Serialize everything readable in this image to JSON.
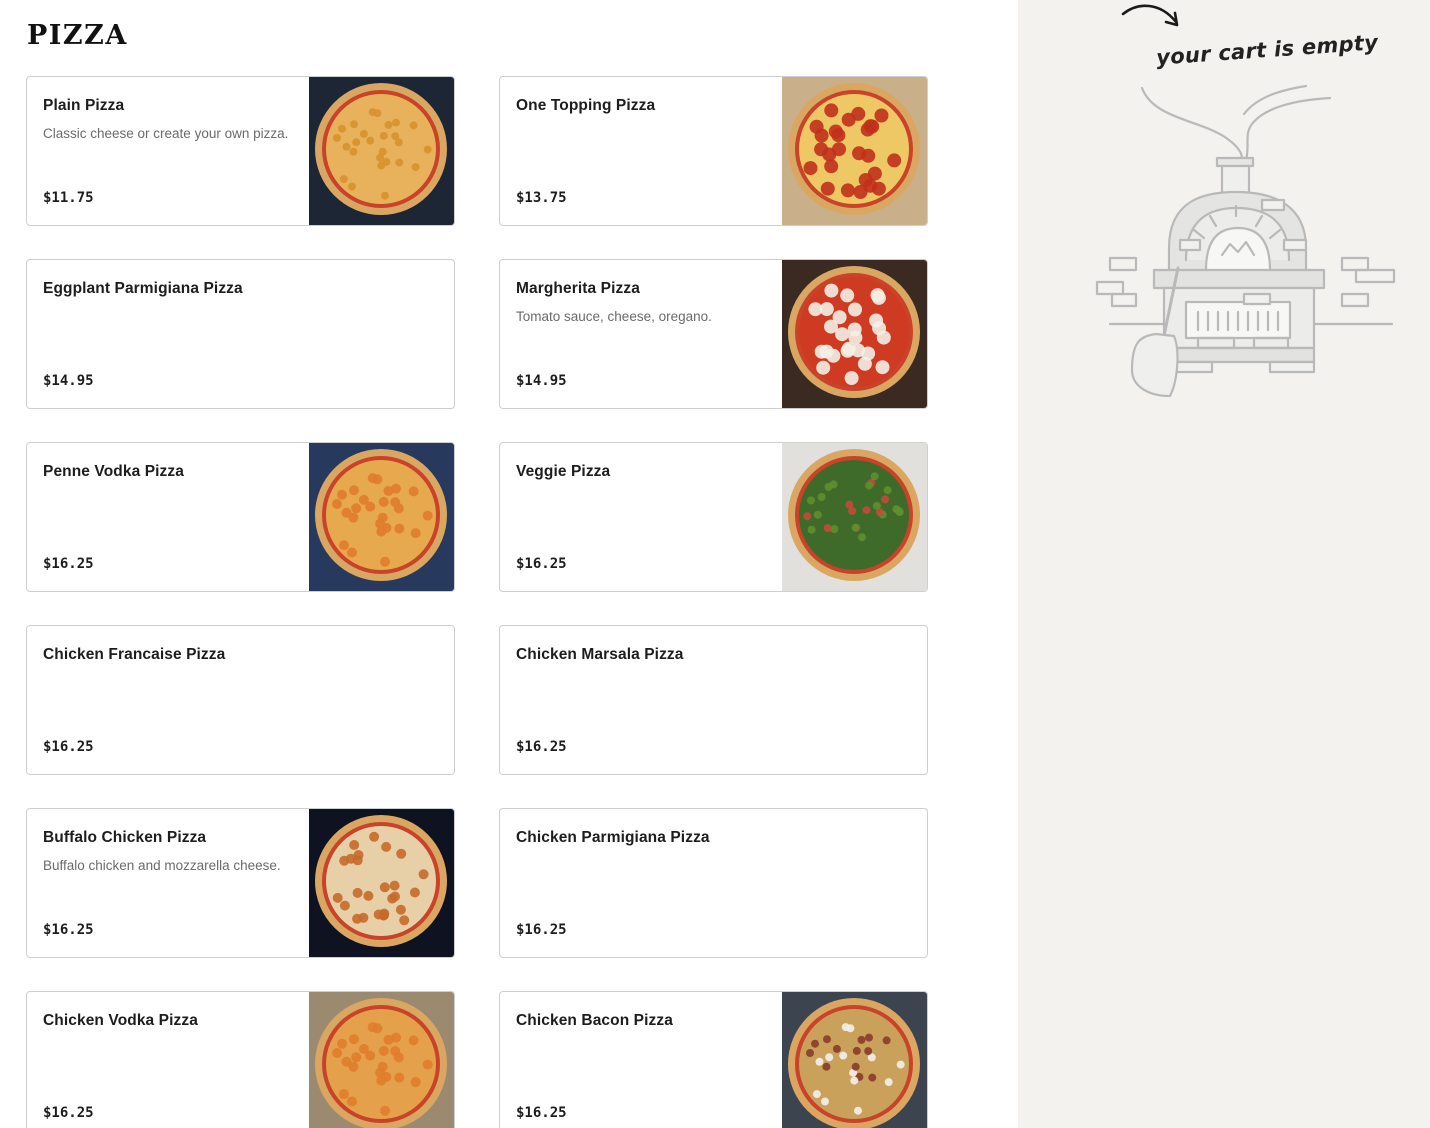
{
  "section": {
    "title": "PIZZA"
  },
  "items": [
    {
      "name": "Plain Pizza",
      "desc": "Classic cheese or create your own pizza.",
      "price": "$11.75",
      "image": "plain"
    },
    {
      "name": "One Topping Pizza",
      "desc": "",
      "price": "$13.75",
      "image": "pepperoni"
    },
    {
      "name": "Eggplant Parmigiana Pizza",
      "desc": "",
      "price": "$14.95",
      "image": null
    },
    {
      "name": "Margherita Pizza",
      "desc": "Tomato sauce, cheese, oregano.",
      "price": "$14.95",
      "image": "margherita"
    },
    {
      "name": "Penne Vodka Pizza",
      "desc": "",
      "price": "$16.25",
      "image": "penne"
    },
    {
      "name": "Veggie Pizza",
      "desc": "",
      "price": "$16.25",
      "image": "veggie"
    },
    {
      "name": "Chicken Francaise Pizza",
      "desc": "",
      "price": "$16.25",
      "image": null
    },
    {
      "name": "Chicken Marsala Pizza",
      "desc": "",
      "price": "$16.25",
      "image": null
    },
    {
      "name": "Buffalo Chicken Pizza",
      "desc": "Buffalo chicken and mozzarella cheese.",
      "price": "$16.25",
      "image": "buffalo"
    },
    {
      "name": "Chicken Parmigiana Pizza",
      "desc": "",
      "price": "$16.25",
      "image": null
    },
    {
      "name": "Chicken Vodka Pizza",
      "desc": "",
      "price": "$16.25",
      "image": "vodka"
    },
    {
      "name": "Chicken Bacon Pizza",
      "desc": "",
      "price": "$16.25",
      "image": "bacon"
    }
  ],
  "cart": {
    "empty_label": "your cart is empty",
    "illustration": "pizza-oven-icon"
  },
  "colors": {
    "cart_bg": "#f3f2ef",
    "card_border": "#cfcfcf",
    "text": "#1d1d1d",
    "muted": "#6b6b6b"
  }
}
